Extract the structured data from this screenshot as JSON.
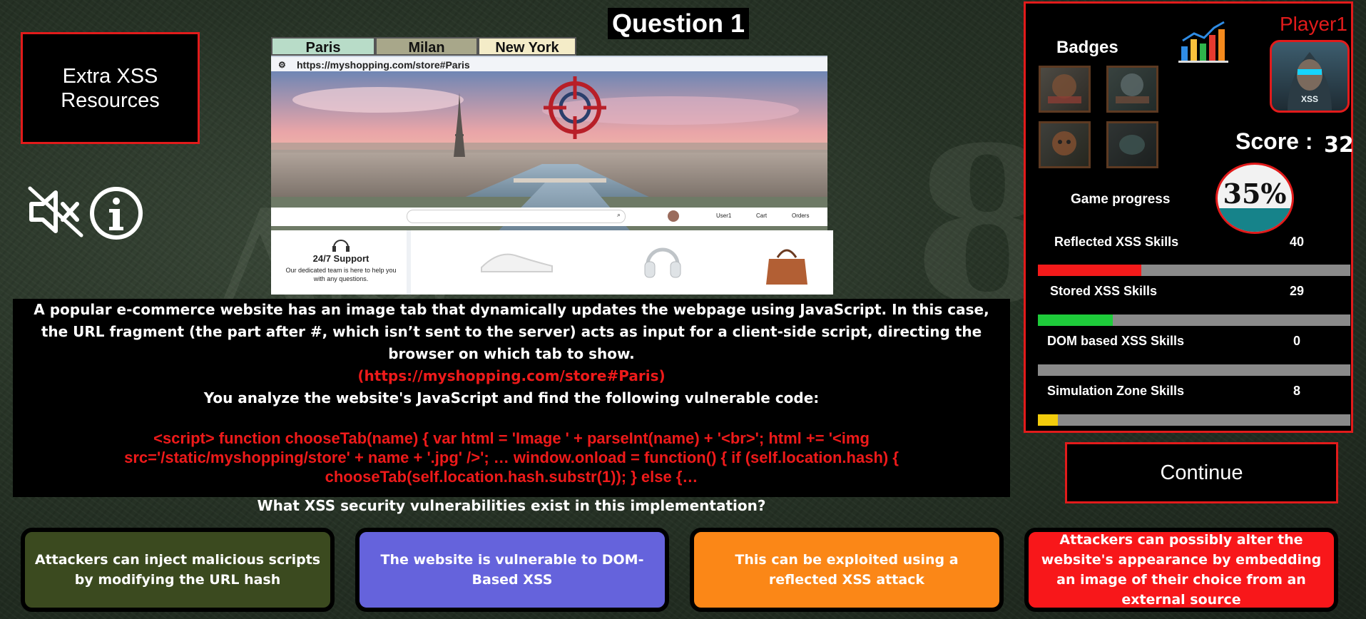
{
  "extra_resources": "Extra XSS Resources",
  "question_title": "Question 1",
  "preview": {
    "tabs": [
      "Paris",
      "Milan",
      "New York"
    ],
    "url": "https://myshopping.com/store#Paris",
    "nav": {
      "user": "User1",
      "cart": "Cart",
      "orders": "Orders"
    },
    "support_title": "24/7 Support",
    "support_text": "Our dedicated team is here to help you with any questions."
  },
  "question": {
    "intro": "A popular e-commerce website has an image tab that dynamically updates the webpage using JavaScript. In this case, the URL fragment (the part after #, which isn’t sent to the server) acts as input for a client-side script, directing the browser on which tab to show.",
    "url": "(https://myshopping.com/store#Paris)",
    "analyze": "You analyze the website's JavaScript and find the following vulnerable code:",
    "code": "<script> function chooseTab(name) { var html = 'Image ' + parseInt(name) + '<br>'; html += '<img src='/static/myshopping/store' + name + '.jpg' />'; … window.onload = function() { if (self.location.hash) { chooseTab(self.location.hash.substr(1)); } else {…",
    "prompt": "What XSS security vulnerabilities exist in this implementation?"
  },
  "answers": [
    {
      "text": "Attackers can inject malicious scripts by modifying the URL hash",
      "color": "#3b4a1f"
    },
    {
      "text": "The website is vulnerable to DOM-Based XSS",
      "color": "#6563dc"
    },
    {
      "text": "This can be exploited using a reflected XSS attack",
      "color": "#fb8717"
    },
    {
      "text": "Attackers can possibly alter the website's appearance by embedding an image of their choice from an external source",
      "color": "#f8171a"
    }
  ],
  "panel": {
    "player": "Player1",
    "badges_label": "Badges",
    "score_label": "Score :",
    "score": "32",
    "progress_label": "Game progress",
    "progress_text": "35%",
    "progress": 0.35,
    "avatar_text": "XSS",
    "badge_names": [
      "attacker-completed-badge",
      "defender-completed-badge",
      "robot-badge",
      "mask-badge"
    ],
    "skills": [
      {
        "label": "Reflected XSS Skills",
        "value": "40",
        "fraction": 0.33,
        "color": "#f41a1a"
      },
      {
        "label": "Stored XSS Skills",
        "value": "29",
        "fraction": 0.24,
        "color": "#1ecb3a"
      },
      {
        "label": "DOM based XSS Skills",
        "value": "0",
        "fraction": 0.0,
        "color": "#1e88e5"
      },
      {
        "label": "Simulation Zone Skills",
        "value": "8",
        "fraction": 0.065,
        "color": "#f2cc0c"
      }
    ]
  },
  "continue": "Continue",
  "colors": {
    "accent_red": "#e21b1b",
    "progress_teal": "#16838a"
  }
}
